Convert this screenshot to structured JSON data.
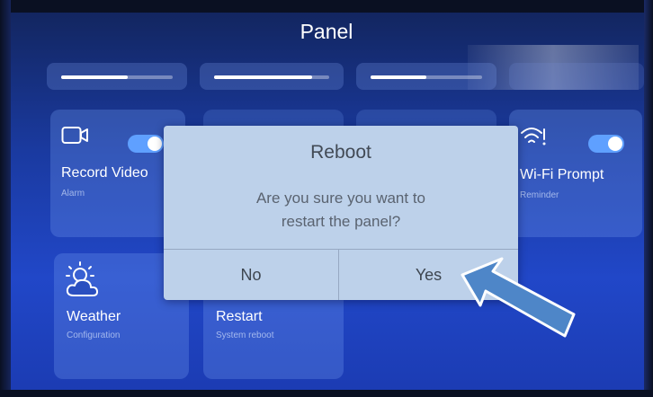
{
  "header": {
    "title": "Panel"
  },
  "tiles": {
    "record": {
      "title": "Record Video",
      "subtitle": "Alarm",
      "icon": "video-camera-icon",
      "toggle_on": true
    },
    "wifi": {
      "title": "Wi-Fi Prompt",
      "subtitle": "Reminder",
      "icon": "wifi-question-icon",
      "toggle_on": true
    },
    "weather": {
      "title": "Weather",
      "subtitle": "Configuration",
      "icon": "sun-cloud-icon"
    },
    "restart": {
      "title": "Restart",
      "subtitle": "System reboot"
    }
  },
  "sliders": [
    {
      "name": "slider-1",
      "level": 0.6
    },
    {
      "name": "slider-2",
      "level": 0.85
    },
    {
      "name": "slider-3",
      "level": 0.5
    }
  ],
  "dialog": {
    "title": "Reboot",
    "message_line1": "Are you sure you want to",
    "message_line2": "restart the panel?",
    "no_label": "No",
    "yes_label": "Yes"
  },
  "colors": {
    "accent": "#5fa0ff",
    "dialog_bg": "#bdd1ea",
    "arrow": "#4e86c8"
  }
}
